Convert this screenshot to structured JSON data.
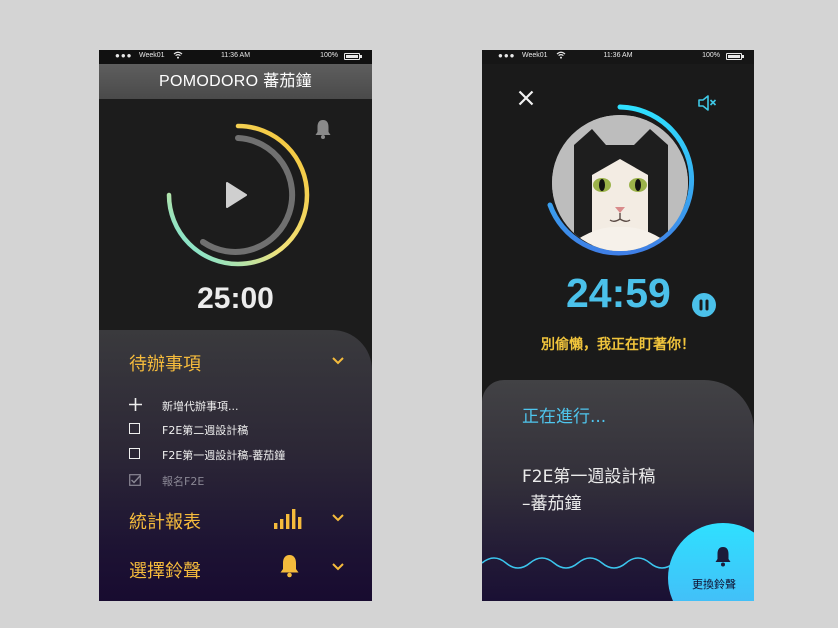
{
  "statusbar": {
    "carrier": "Week01",
    "time": "11:36 AM",
    "battery": "100%"
  },
  "phone1": {
    "title": "POMODORO 蕃茄鐘",
    "timer": "25:00",
    "todo": {
      "title": "待辦事項",
      "add_label": "新增代辦事項...",
      "items": [
        {
          "label": "F2E第二週設計稿",
          "done": false
        },
        {
          "label": "F2E第一週設計稿-蕃茄鐘",
          "done": false
        },
        {
          "label": "報名F2E",
          "done": true
        }
      ]
    },
    "stats_title": "統計報表",
    "ringtone_title": "選擇鈴聲",
    "colors": {
      "accent": "#f5bb3c"
    }
  },
  "phone2": {
    "timer": "24:59",
    "warning": "別偷懶，我正在盯著你！",
    "in_progress_label": "正在進行...",
    "task_line1": "F2E第一週設計稿",
    "task_line2": "–蕃茄鐘",
    "change_bell_label": "更換鈴聲",
    "colors": {
      "accent": "#4bc1ea"
    }
  }
}
